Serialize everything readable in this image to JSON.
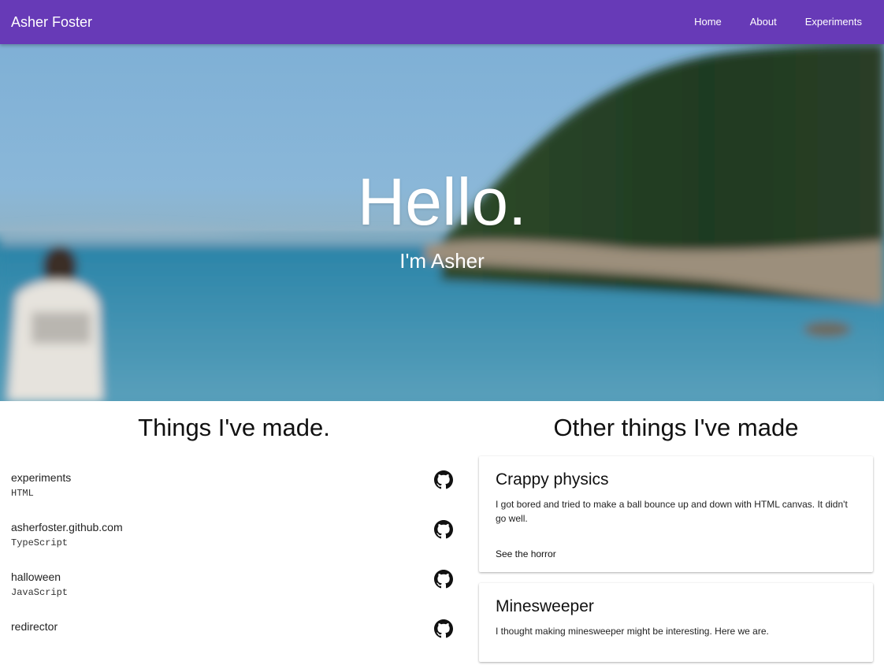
{
  "nav": {
    "brand": "Asher Foster",
    "links": [
      "Home",
      "About",
      "Experiments"
    ]
  },
  "hero": {
    "title": "Hello.",
    "subtitle": "I'm Asher"
  },
  "projects": {
    "title": "Things I've made.",
    "repos": [
      {
        "name": "experiments",
        "language": "HTML"
      },
      {
        "name": "asherfoster.github.com",
        "language": "TypeScript"
      },
      {
        "name": "halloween",
        "language": "JavaScript"
      },
      {
        "name": "redirector",
        "language": ""
      }
    ]
  },
  "other": {
    "title": "Other things I've made",
    "cards": [
      {
        "title": "Crappy physics",
        "text": "I got bored and tried to make a ball bounce up and down with HTML canvas. It didn't go well.",
        "action": "See the horror"
      },
      {
        "title": "Minesweeper",
        "text": "I thought making minesweeper might be interesting. Here we are.",
        "action": ""
      }
    ]
  },
  "colors": {
    "toolbar": "#673ab7",
    "icon": "#111111"
  },
  "icons": {
    "repo_link": "github-icon"
  }
}
